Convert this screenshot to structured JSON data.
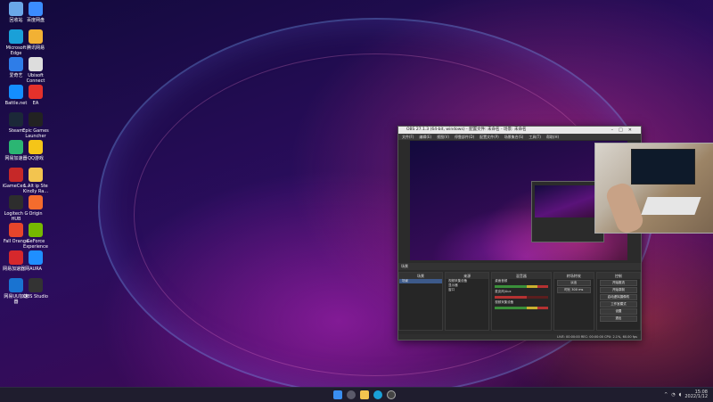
{
  "desktop": {
    "icons": [
      {
        "label": "回收站",
        "icon": "recycle-bin-icon",
        "color": "#6aa7e8"
      },
      {
        "label": "百度网盘",
        "icon": "baidu-netdisk-icon",
        "color": "#3b8cff"
      },
      {
        "label": "Microsoft Edge",
        "icon": "edge-icon",
        "color": "#1aa0d8"
      },
      {
        "label": "腾讯网易",
        "icon": "game-icon",
        "color": "#f2b134"
      },
      {
        "label": "爱奇艺",
        "icon": "app-icon",
        "color": "#2e7de8"
      },
      {
        "label": "Ubisoft Connect",
        "icon": "ubisoft-icon",
        "color": "#dddddd"
      },
      {
        "label": "Battle.net",
        "icon": "battlenet-icon",
        "color": "#148eff"
      },
      {
        "label": "EA",
        "icon": "ea-icon",
        "color": "#e4312b"
      },
      {
        "label": "Steam",
        "icon": "steam-icon",
        "color": "#1b2838"
      },
      {
        "label": "Epic Games Launcher",
        "icon": "epic-icon",
        "color": "#222222"
      },
      {
        "label": "网易加速器",
        "icon": "accelerator-icon",
        "color": "#2bb673"
      },
      {
        "label": "QQ游戏",
        "icon": "qq-game-icon",
        "color": "#f5c518"
      },
      {
        "label": "iGameCen...",
        "icon": "igame-icon",
        "color": "#c62828"
      },
      {
        "label": "1 Alt ip Ste Kindly Ra...",
        "icon": "folder-icon",
        "color": "#f3c44f"
      },
      {
        "label": "Logitech G HUB",
        "icon": "logitech-icon",
        "color": "#2d2d2d"
      },
      {
        "label": "Origin",
        "icon": "origin-icon",
        "color": "#f56c2d"
      },
      {
        "label": "Fall Orange",
        "icon": "app-icon",
        "color": "#e6452b"
      },
      {
        "label": "GeForce Experience",
        "icon": "nvidia-icon",
        "color": "#76b900"
      },
      {
        "label": "网易加速器网",
        "icon": "app-icon",
        "color": "#d6282c"
      },
      {
        "label": "AURA",
        "icon": "aura-icon",
        "color": "#1f8fff"
      },
      {
        "label": "网易UU加速器",
        "icon": "uu-icon",
        "color": "#1973d1"
      },
      {
        "label": "OBS Studio",
        "icon": "obs-icon",
        "color": "#333333"
      }
    ]
  },
  "obs": {
    "title": "OBS 27.1.3 (64-bit, windows) - 配置文件: 未命名 - 场景: 未命名",
    "menu": [
      "文件(F)",
      "编辑(E)",
      "视图(V)",
      "停靠部件(D)",
      "配置文件(P)",
      "场景集合(S)",
      "工具(T)",
      "帮助(H)"
    ],
    "scene_bar_label": "场景",
    "docks": {
      "scenes": {
        "head": "场景",
        "items": [
          "场景"
        ]
      },
      "sources": {
        "head": "来源",
        "items": [
          "视频采集设备",
          "显示器",
          "窗口"
        ]
      },
      "mixer": {
        "head": "混音器",
        "items": [
          "桌面音频",
          "麦克风/Aux",
          "视频采集设备"
        ]
      },
      "transitions": {
        "head": "转场特效",
        "items": [
          "淡出",
          "时长 300 ms"
        ]
      },
      "controls": {
        "head": "控制",
        "items": [
          "开始推流",
          "开始录制",
          "启动虚拟摄像机",
          "工作室模式",
          "设置",
          "退出"
        ]
      }
    },
    "status": "LIVE: 00:00:00  REC: 00:00:00  CPU: 2.1%, 60.00 fps"
  },
  "taskbar": {
    "clock_time": "15:08",
    "clock_date": "2022/1/12"
  }
}
